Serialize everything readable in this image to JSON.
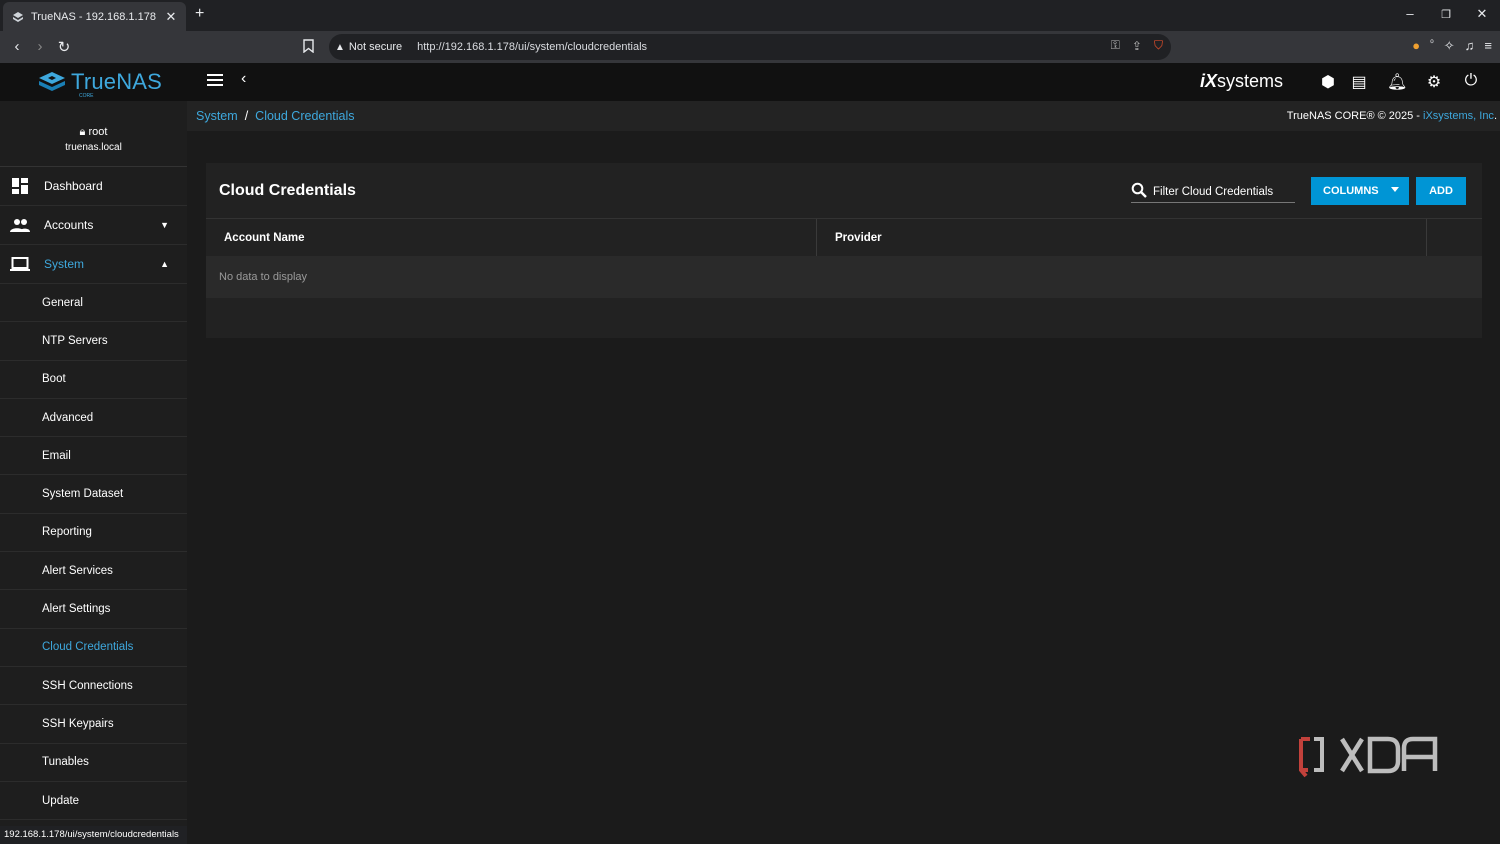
{
  "browser": {
    "tab_title": "TrueNAS - 192.168.1.178",
    "new_tab": "+",
    "security_label": "Not secure",
    "url": "http://192.168.1.178/ui/system/cloudcredentials",
    "status_url": "192.168.1.178/ui/system/cloudcredentials"
  },
  "app": {
    "logo_text": "TrueNAS",
    "logo_sub": "CORE",
    "vendor_logo": "systems",
    "vendor_logo_prefix": "iX"
  },
  "user": {
    "name": "root",
    "host": "truenas.local"
  },
  "sidebar": {
    "items": [
      {
        "label": "Dashboard",
        "icon": "dashboard-icon"
      },
      {
        "label": "Accounts",
        "icon": "people-icon"
      },
      {
        "label": "System",
        "icon": "laptop-icon"
      }
    ],
    "sub_items": [
      "General",
      "NTP Servers",
      "Boot",
      "Advanced",
      "Email",
      "System Dataset",
      "Reporting",
      "Alert Services",
      "Alert Settings",
      "Cloud Credentials",
      "SSH Connections",
      "SSH Keypairs",
      "Tunables",
      "Update"
    ],
    "active_sub": "Cloud Credentials"
  },
  "breadcrumb": {
    "parent": "System",
    "separator": "/",
    "current": "Cloud Credentials"
  },
  "copyright": {
    "text": "TrueNAS CORE® © 2025 - ",
    "vendor": "iXsystems, Inc",
    "suffix": "."
  },
  "card": {
    "title": "Cloud Credentials",
    "filter_placeholder": "Filter Cloud Credentials",
    "columns_button": "COLUMNS",
    "add_button": "ADD",
    "columns": [
      "Account Name",
      "Provider"
    ],
    "empty_message": "No data to display"
  },
  "watermark": "XDA",
  "colors": {
    "accent": "#3ea8dd",
    "button": "#0095d5",
    "topbar": "#111111",
    "background": "#1b1b1b"
  }
}
